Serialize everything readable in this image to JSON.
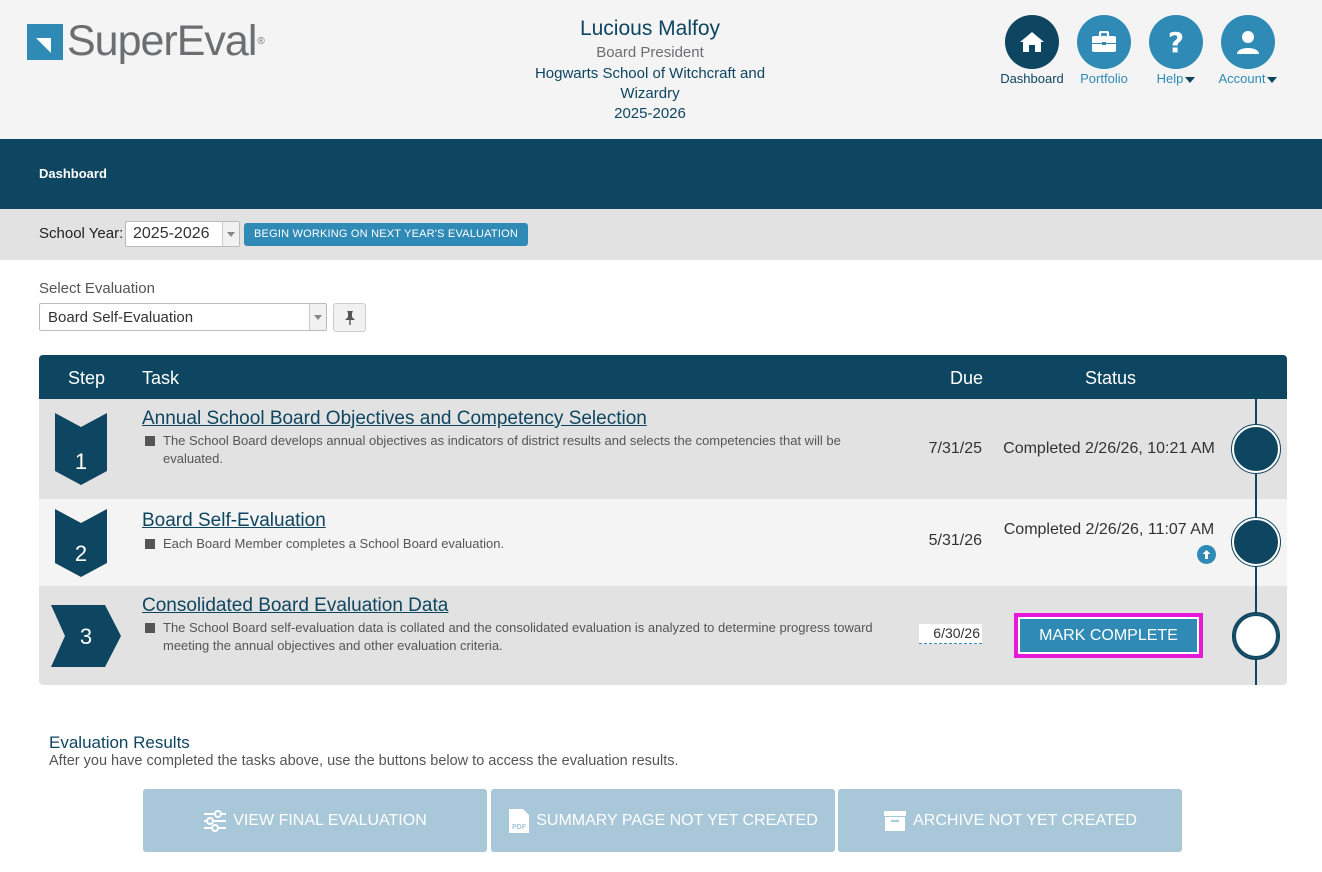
{
  "header": {
    "logo_text": "SuperEval",
    "logo_reg": "®",
    "user_name": "Lucious Malfoy",
    "user_role": "Board President",
    "school": "Hogwarts School of Witchcraft and Wizardry",
    "year": "2025-2026"
  },
  "topnav": [
    {
      "label": "Dashboard",
      "icon": "home-icon"
    },
    {
      "label": "Portfolio",
      "icon": "briefcase-icon"
    },
    {
      "label": "Help",
      "icon": "question-icon"
    },
    {
      "label": "Account",
      "icon": "user-icon"
    }
  ],
  "breadcrumb": "Dashboard",
  "yearbar": {
    "label": "School Year:",
    "selected": "2025-2026",
    "next_button": "BEGIN WORKING ON NEXT YEAR'S EVALUATION"
  },
  "evaluation_select": {
    "label": "Select Evaluation",
    "selected": "Board Self-Evaluation"
  },
  "table": {
    "headers": {
      "step": "Step",
      "task": "Task",
      "due": "Due",
      "status": "Status"
    },
    "rows": [
      {
        "step": "1",
        "title": "Annual School Board Objectives and Competency Selection",
        "description": "The School Board develops annual objectives as indicators of district results and selects the competencies that will be evaluated.",
        "due": "7/31/25",
        "status": "Completed 2/26/26, 10:21 AM"
      },
      {
        "step": "2",
        "title": "Board Self-Evaluation",
        "description": "Each Board Member completes a School Board evaluation.",
        "due": "5/31/26",
        "status": "Completed 2/26/26, 11:07 AM"
      },
      {
        "step": "3",
        "title": "Consolidated Board Evaluation Data",
        "description": "The School Board self-evaluation data is collated and the consolidated evaluation is analyzed to determine progress toward meeting the annual objectives and other evaluation criteria.",
        "due": "6/30/26",
        "status_button": "MARK COMPLETE"
      }
    ]
  },
  "results": {
    "title": "Evaluation Results",
    "subtitle": "After you have completed the tasks above, use the buttons below to access the evaluation results.",
    "buttons": [
      {
        "label": "VIEW FINAL EVALUATION",
        "icon": "sliders-icon"
      },
      {
        "label": "SUMMARY PAGE NOT YET CREATED",
        "icon": "pdf-icon"
      },
      {
        "label": "ARCHIVE NOT YET CREATED",
        "icon": "archive-icon"
      }
    ]
  },
  "colors": {
    "navy": "#0e4560",
    "accent_blue": "#2f8ab6",
    "highlight_magenta": "#e619d9",
    "disabled_blue": "#a8c7d8"
  }
}
